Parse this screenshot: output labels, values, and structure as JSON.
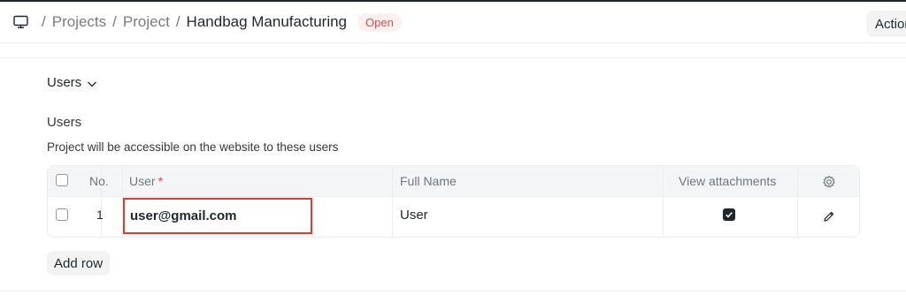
{
  "breadcrumb": {
    "icon": "desktop-icon",
    "separator": "/",
    "items": [
      "Projects",
      "Project"
    ],
    "current": "Handbag Manufacturing"
  },
  "status": {
    "label": "Open",
    "color": "#e24c4c"
  },
  "actions": {
    "label": "Actions"
  },
  "section": {
    "title": "Users",
    "icon": "chevron-down-icon"
  },
  "field": {
    "label": "Users",
    "description": "Project will be accessible on the website to these users"
  },
  "table": {
    "columns": {
      "no": "No.",
      "user": "User",
      "required_mark": "*",
      "full_name": "Full Name",
      "view_attachments": "View attachments",
      "settings_icon": "gear-icon"
    },
    "rows": [
      {
        "no": "1",
        "user": "user@gmail.com",
        "full_name": "User",
        "view_attachments": true,
        "edit_icon": "pencil-icon"
      }
    ]
  },
  "add_row": {
    "label": "Add row"
  },
  "highlight_color": "#e03c2c"
}
